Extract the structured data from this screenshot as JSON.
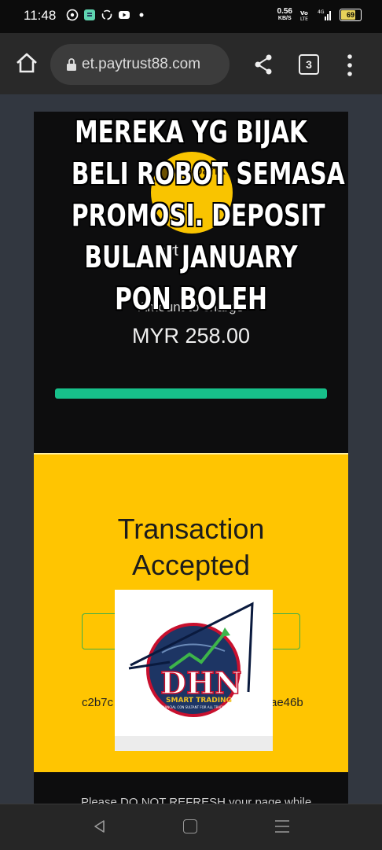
{
  "status_bar": {
    "time": "11:48",
    "speed_value": "0.56",
    "speed_unit": "KB/S",
    "battery": "69"
  },
  "browser": {
    "url": "et.paytrust88.com",
    "tab_count": "3"
  },
  "payment": {
    "bank_logo_text": "Maybank",
    "merchant_partial": "ayt",
    "amount_label": "Amount to charge",
    "amount": "MYR 258.00",
    "progress": 1.0,
    "accent_color": "#17c08a"
  },
  "overlay": {
    "lines": [
      "MEREKA YG BIJAK",
      "BELI ROBOT SEMASA",
      "PROMOSI. DEPOSIT",
      "BULAN JANUARY",
      "PON BOLEH"
    ]
  },
  "transaction": {
    "title_line1": "Transaction",
    "title_line2": "Accepted",
    "hash_start": "c2b7c",
    "hash_end": "ae46b"
  },
  "watermark": {
    "brand": "DHN",
    "tagline": "SMART TRADING",
    "subtagline": "FINANCIAL CON SULTANT FOR ALL TRADERS"
  },
  "footer_notice": "Please DO NOT REFRESH your page while"
}
